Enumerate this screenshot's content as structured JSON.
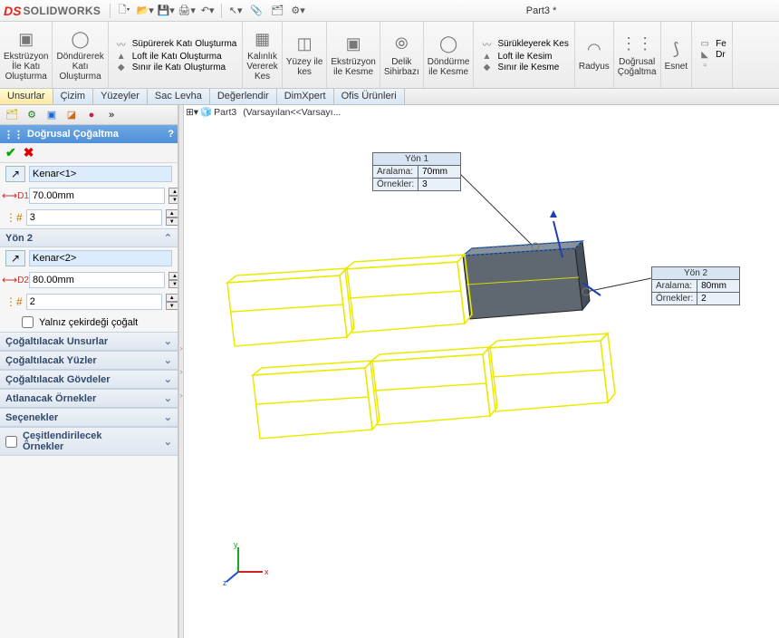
{
  "app": {
    "logo_brand": "DS",
    "logo_name": "SOLIDWORKS",
    "doc_title": "Part3 *"
  },
  "ribbon": {
    "extrude": "Ekstrüzyon\nİle Katı\nOluşturma",
    "revolve": "Döndürerek\nKatı\nOluşturma",
    "sweep": "Süpürerek Katı Oluşturma",
    "loft": "Loft ile Katı Oluşturma",
    "boundary": "Sınır ile Katı Oluşturma",
    "thickness": "Kalınlık\nVererek\nKes",
    "surface_cut": "Yüzey ile\nkes",
    "extrude_cut": "Ekstrüzyon\nile Kesme",
    "hole_wizard": "Delik\nSihirbazı",
    "revolve_cut": "Döndürme\nile Kesme",
    "sweep_cut": "Sürükleyerek Kes",
    "loft_cut": "Loft ile Kesim",
    "boundary_cut": "Sınır ile Kesme",
    "radius": "Radyus",
    "linear_pattern": "Doğrusal\nÇoğaltma",
    "flex": "Esnet",
    "draft": "Dr",
    "fe": "Fe"
  },
  "tabs": [
    "Unsurlar",
    "Çizim",
    "Yüzeyler",
    "Sac Levha",
    "Değerlendir",
    "DimXpert",
    "Ofis Ürünleri"
  ],
  "panel": {
    "title": "Doğrusal Çoğaltma",
    "help": "?",
    "edge1": "Kenar<1>",
    "d1": "70.00mm",
    "count1": "3",
    "dir2_label": "Yön 2",
    "edge2": "Kenar<2>",
    "d2": "80.00mm",
    "count2": "2",
    "only_seed": "Yalnız çekirdeği çoğalt",
    "features_to_pattern": "Çoğaltılacak Unsurlar",
    "faces_to_pattern": "Çoğaltılacak Yüzler",
    "bodies_to_pattern": "Çoğaltılacak Gövdeler",
    "skip": "Atlanacak Örnekler",
    "options": "Seçenekler",
    "vary": "Çeşitlendirilecek\nÖrnekler"
  },
  "breadcrumb": {
    "part": "Part3",
    "config": "(Varsayılan<<Varsayı..."
  },
  "callout1": {
    "title": "Yön 1",
    "spacing_label": "Aralama:",
    "spacing": "70mm",
    "instances_label": "Örnekler:",
    "instances": "3"
  },
  "callout2": {
    "title": "Yön 2",
    "spacing_label": "Aralama:",
    "spacing": "80mm",
    "instances_label": "Örnekler:",
    "instances": "2"
  },
  "axes": {
    "x": "x",
    "y": "y",
    "z": "z"
  }
}
